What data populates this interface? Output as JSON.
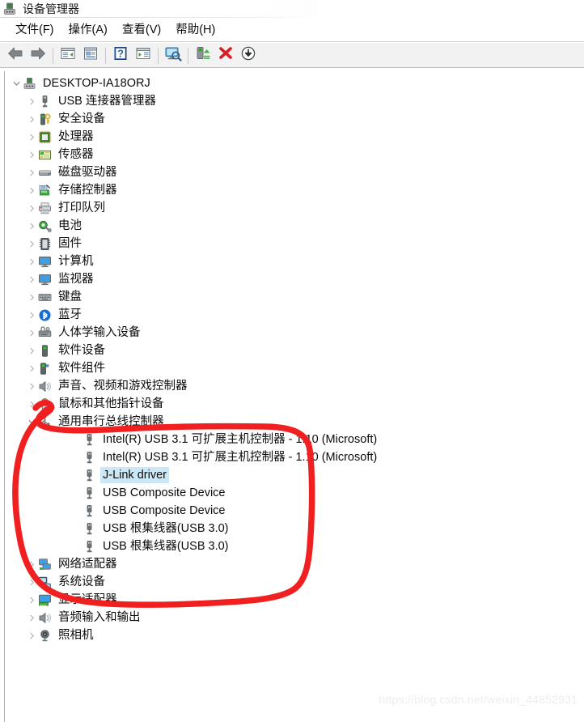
{
  "window": {
    "title": "设备管理器",
    "icon": "device-manager-icon"
  },
  "menu": {
    "items": [
      {
        "label": "文件(F)",
        "name": "menu-file"
      },
      {
        "label": "操作(A)",
        "name": "menu-action"
      },
      {
        "label": "查看(V)",
        "name": "menu-view"
      },
      {
        "label": "帮助(H)",
        "name": "menu-help"
      }
    ]
  },
  "toolbar": {
    "buttons": [
      {
        "icon": "back-arrow-icon",
        "name": "toolbar-back"
      },
      {
        "icon": "forward-arrow-icon",
        "name": "toolbar-forward"
      },
      {
        "icon": "separator",
        "name": "toolbar-separator-1"
      },
      {
        "icon": "tree-pane-icon",
        "name": "toolbar-show-hide-console-tree"
      },
      {
        "icon": "properties-icon",
        "name": "toolbar-properties"
      },
      {
        "icon": "separator",
        "name": "toolbar-separator-2"
      },
      {
        "icon": "help-question-icon",
        "name": "toolbar-help"
      },
      {
        "icon": "action-pane-icon",
        "name": "toolbar-show-hide-action-pane"
      },
      {
        "icon": "separator",
        "name": "toolbar-separator-3"
      },
      {
        "icon": "scan-hardware-icon",
        "name": "toolbar-scan-for-hardware-changes"
      },
      {
        "icon": "separator",
        "name": "toolbar-separator-4"
      },
      {
        "icon": "update-driver-icon",
        "name": "toolbar-update-driver"
      },
      {
        "icon": "uninstall-device-icon",
        "name": "toolbar-uninstall-device"
      },
      {
        "icon": "disable-device-icon",
        "name": "toolbar-disable-device"
      }
    ]
  },
  "tree": {
    "nodes": [
      {
        "label": "DESKTOP-IA18ORJ",
        "level": 0,
        "expander": "expanded",
        "icon": "computer-root-icon",
        "selected": false
      },
      {
        "label": "USB 连接器管理器",
        "level": 1,
        "expander": "collapsed",
        "icon": "usb-icon",
        "selected": false
      },
      {
        "label": "安全设备",
        "level": 1,
        "expander": "collapsed",
        "icon": "security-device-icon",
        "selected": false
      },
      {
        "label": "处理器",
        "level": 1,
        "expander": "collapsed",
        "icon": "processor-icon",
        "selected": false
      },
      {
        "label": "传感器",
        "level": 1,
        "expander": "collapsed",
        "icon": "sensor-icon",
        "selected": false
      },
      {
        "label": "磁盘驱动器",
        "level": 1,
        "expander": "collapsed",
        "icon": "disk-drive-icon",
        "selected": false
      },
      {
        "label": "存储控制器",
        "level": 1,
        "expander": "collapsed",
        "icon": "storage-controller-icon",
        "selected": false
      },
      {
        "label": "打印队列",
        "level": 1,
        "expander": "collapsed",
        "icon": "print-queue-icon",
        "selected": false
      },
      {
        "label": "电池",
        "level": 1,
        "expander": "collapsed",
        "icon": "battery-icon",
        "selected": false
      },
      {
        "label": "固件",
        "level": 1,
        "expander": "collapsed",
        "icon": "firmware-icon",
        "selected": false
      },
      {
        "label": "计算机",
        "level": 1,
        "expander": "collapsed",
        "icon": "computer-icon",
        "selected": false
      },
      {
        "label": "监视器",
        "level": 1,
        "expander": "collapsed",
        "icon": "monitor-icon",
        "selected": false
      },
      {
        "label": "键盘",
        "level": 1,
        "expander": "collapsed",
        "icon": "keyboard-icon",
        "selected": false
      },
      {
        "label": "蓝牙",
        "level": 1,
        "expander": "collapsed",
        "icon": "bluetooth-icon",
        "selected": false
      },
      {
        "label": "人体学输入设备",
        "level": 1,
        "expander": "collapsed",
        "icon": "hid-icon",
        "selected": false
      },
      {
        "label": "软件设备",
        "level": 1,
        "expander": "collapsed",
        "icon": "software-device-icon",
        "selected": false
      },
      {
        "label": "软件组件",
        "level": 1,
        "expander": "collapsed",
        "icon": "software-component-icon",
        "selected": false
      },
      {
        "label": "声音、视频和游戏控制器",
        "level": 1,
        "expander": "collapsed",
        "icon": "sound-video-game-icon",
        "selected": false
      },
      {
        "label": "鼠标和其他指针设备",
        "level": 1,
        "expander": "collapsed",
        "icon": "mouse-icon",
        "selected": false
      },
      {
        "label": "通用串行总线控制器",
        "level": 1,
        "expander": "expanded",
        "icon": "usb-controller-icon",
        "selected": false
      },
      {
        "label": "Intel(R) USB 3.1 可扩展主机控制器 - 1.10 (Microsoft)",
        "level": 2,
        "expander": "none",
        "icon": "usb-device-icon",
        "selected": false
      },
      {
        "label": "Intel(R) USB 3.1 可扩展主机控制器 - 1.10 (Microsoft)",
        "level": 2,
        "expander": "none",
        "icon": "usb-device-icon",
        "selected": false
      },
      {
        "label": "J-Link driver",
        "level": 2,
        "expander": "none",
        "icon": "usb-device-icon",
        "selected": true
      },
      {
        "label": "USB Composite Device",
        "level": 2,
        "expander": "none",
        "icon": "usb-device-icon",
        "selected": false
      },
      {
        "label": "USB Composite Device",
        "level": 2,
        "expander": "none",
        "icon": "usb-device-icon",
        "selected": false
      },
      {
        "label": "USB 根集线器(USB 3.0)",
        "level": 2,
        "expander": "none",
        "icon": "usb-device-icon",
        "selected": false
      },
      {
        "label": "USB 根集线器(USB 3.0)",
        "level": 2,
        "expander": "none",
        "icon": "usb-device-icon",
        "selected": false
      },
      {
        "label": "网络适配器",
        "level": 1,
        "expander": "collapsed",
        "icon": "network-adapter-icon",
        "selected": false
      },
      {
        "label": "系统设备",
        "level": 1,
        "expander": "collapsed",
        "icon": "system-device-icon",
        "selected": false
      },
      {
        "label": "显示适配器",
        "level": 1,
        "expander": "collapsed",
        "icon": "display-adapter-icon",
        "selected": false
      },
      {
        "label": "音频输入和输出",
        "level": 1,
        "expander": "collapsed",
        "icon": "audio-io-icon",
        "selected": false
      },
      {
        "label": "照相机",
        "level": 1,
        "expander": "collapsed",
        "icon": "camera-icon",
        "selected": false
      }
    ]
  },
  "annotation": {
    "name": "red-circle-annotation",
    "color": "#f02020",
    "shape": "hand-drawn-loop"
  },
  "watermark": {
    "text": "https://blog.csdn.net/weixin_44852931"
  },
  "colors": {
    "selection": "#cce8f7",
    "toolbar_bg": "#f2f2f2",
    "annotation_red": "#f02020",
    "text": "#0b0b0b"
  }
}
